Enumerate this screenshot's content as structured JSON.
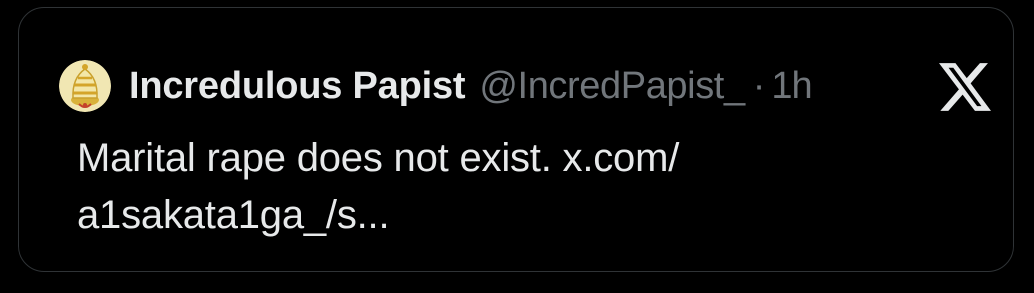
{
  "quoted_post": {
    "author": {
      "display_name": "Incredulous Papist",
      "handle": "@IncredPapist_",
      "avatar_icon": "papal-tiara-avatar"
    },
    "separator": "·",
    "timestamp": "1h",
    "platform_icon": "x-logo-icon",
    "text": "Marital rape does not exist. x.com/\na1sakata1ga_/s..."
  },
  "colors": {
    "background": "#000000",
    "border": "#2f3336",
    "primary_text": "#e7e9ea",
    "secondary_text": "#71767b"
  }
}
